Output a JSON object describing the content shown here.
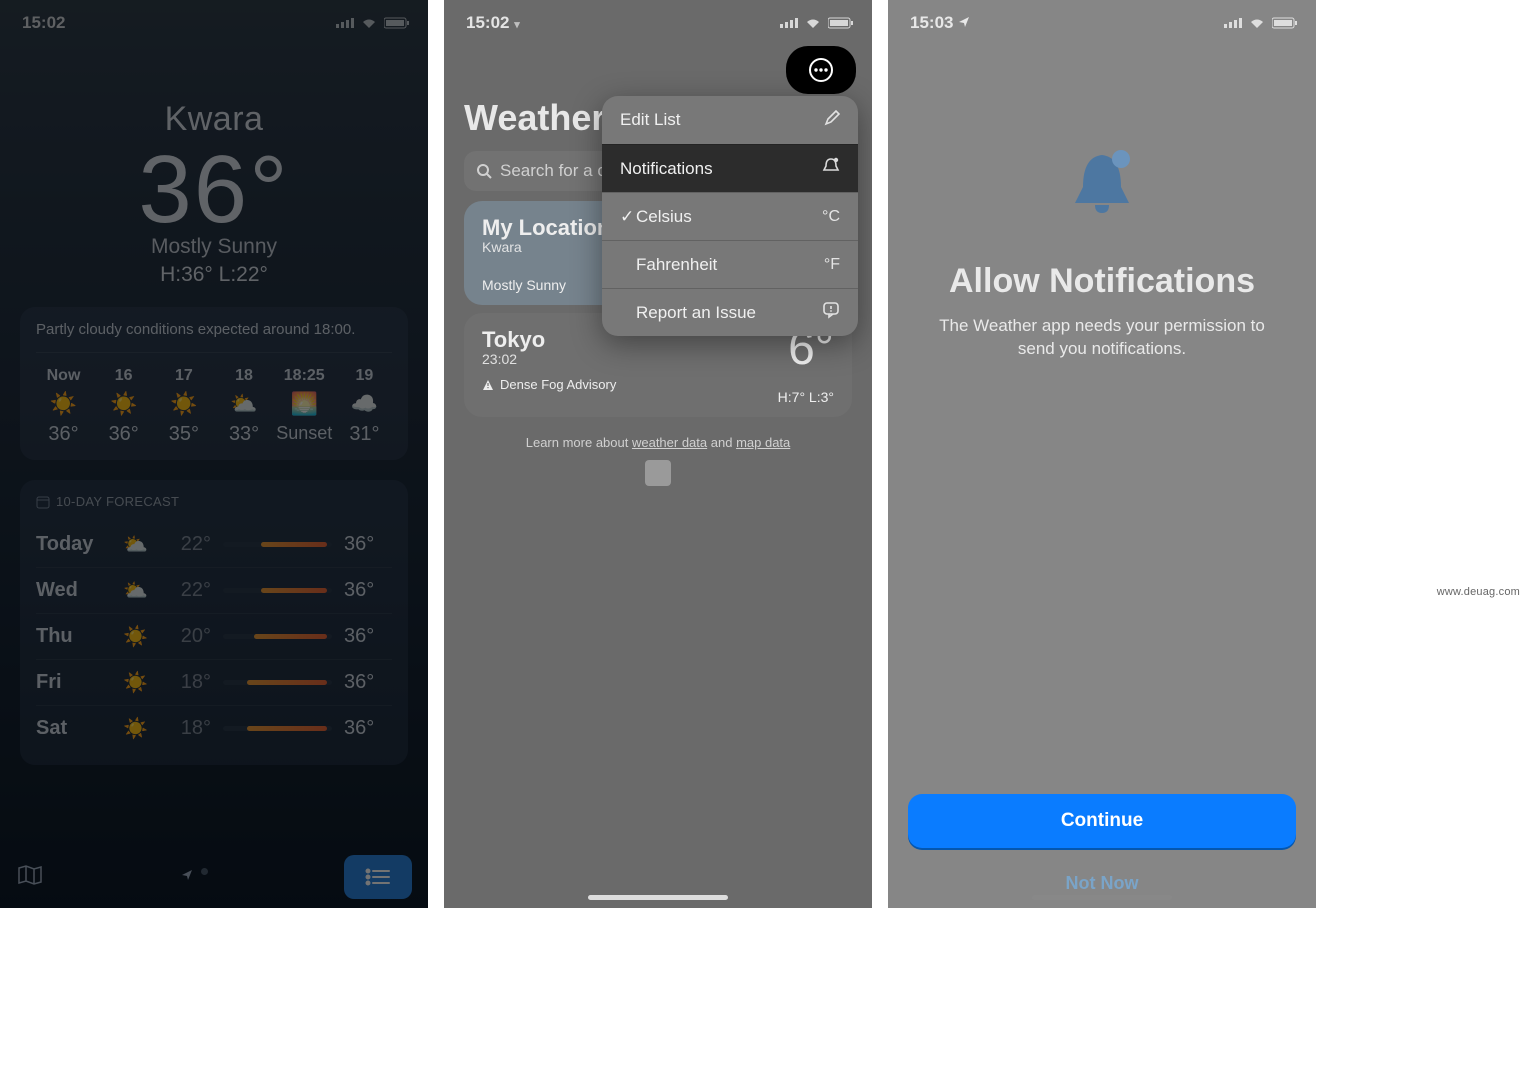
{
  "watermark": "www.deuag.com",
  "screen1": {
    "status": {
      "time": "15:02"
    },
    "hero": {
      "location": "Kwara",
      "temp": "36°",
      "condition": "Mostly Sunny",
      "hilo": "H:36°  L:22°"
    },
    "summary": "Partly cloudy conditions expected around 18:00.",
    "hourly": [
      {
        "time": "Now",
        "icon": "☀️",
        "temp": "36°"
      },
      {
        "time": "16",
        "icon": "☀️",
        "temp": "36°"
      },
      {
        "time": "17",
        "icon": "☀️",
        "temp": "35°"
      },
      {
        "time": "18",
        "icon": "⛅",
        "temp": "33°"
      },
      {
        "time": "18:25",
        "icon": "🌅",
        "temp": "Sunset"
      },
      {
        "time": "19",
        "icon": "☁️",
        "temp": "31°"
      }
    ],
    "tenday_title": "10-DAY FORECAST",
    "daily": [
      {
        "day": "Today",
        "icon": "⛅",
        "low": "22°",
        "high": "36°",
        "barLeft": 35,
        "barRight": 95
      },
      {
        "day": "Wed",
        "icon": "⛅",
        "low": "22°",
        "high": "36°",
        "barLeft": 35,
        "barRight": 95
      },
      {
        "day": "Thu",
        "icon": "☀️",
        "low": "20°",
        "high": "36°",
        "barLeft": 28,
        "barRight": 95
      },
      {
        "day": "Fri",
        "icon": "☀️",
        "low": "18°",
        "high": "36°",
        "barLeft": 22,
        "barRight": 95
      },
      {
        "day": "Sat",
        "icon": "☀️",
        "low": "18°",
        "high": "36°",
        "barLeft": 22,
        "barRight": 95
      }
    ]
  },
  "screen2": {
    "status": {
      "time": "15:02"
    },
    "title": "Weather",
    "search_placeholder": "Search for a city or airport",
    "cards": {
      "myloc": {
        "title": "My Location",
        "sub": "Kwara",
        "cond": "Mostly Sunny"
      },
      "tokyo": {
        "title": "Tokyo",
        "sub": "23:02",
        "advisory": "Dense Fog Advisory",
        "temp": "6°",
        "hilo": "H:7°  L:3°"
      }
    },
    "learn": {
      "pre": "Learn more about ",
      "link1": "weather data",
      "mid": " and ",
      "link2": "map data"
    },
    "popup": {
      "edit": "Edit List",
      "notifications": "Notifications",
      "celsius": "Celsius",
      "celsius_sym": "°C",
      "fahrenheit": "Fahrenheit",
      "fahrenheit_sym": "°F",
      "report": "Report an Issue"
    }
  },
  "screen3": {
    "status": {
      "time": "15:03"
    },
    "title": "Allow Notifications",
    "body": "The Weather app needs your permission to send you notifications.",
    "continue": "Continue",
    "notnow": "Not Now"
  }
}
